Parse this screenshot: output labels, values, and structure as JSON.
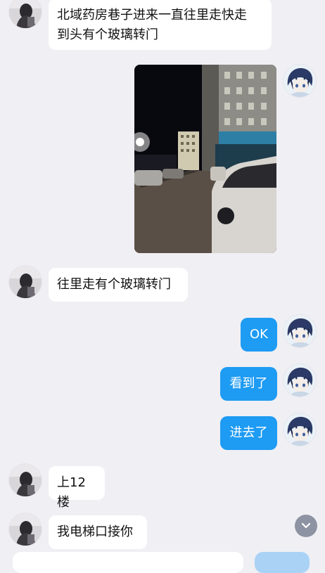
{
  "messages": {
    "m1": "北域药房巷子进来一直往里走快走\n到头有个玻璃转门",
    "m2_image": "street-night-photo",
    "m3": "往里走有个玻璃转门",
    "m4": "OK",
    "m5": "看到了",
    "m6": "进去了",
    "m7": "上12楼",
    "m8": "我电梯口接你"
  },
  "icons": {
    "scroll_down": "chevron-down-icon"
  },
  "colors": {
    "background": "#efeff4",
    "incoming_bubble": "#ffffff",
    "outgoing_bubble": "#1e9bf3",
    "scroll_button": "#8e93a3"
  }
}
